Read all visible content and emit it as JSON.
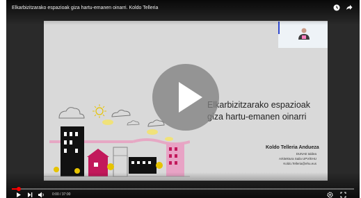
{
  "video": {
    "title": "Elkarbizitzarako espazioak giza hartu-emanen oinarri. Koldo Telleria",
    "time": "0:00 / 37:00",
    "progress_fraction": 0.02
  },
  "slide": {
    "title_line1": "Elkarbizitzarako espazioak",
    "title_line2": "giza hartu-emanen oinarri",
    "author": "Koldo Telleria Andueza",
    "aff_group": "DUNAE taldea",
    "aff_dept": "Arkitektura Saila UPV/EHU",
    "email": "Koldo.Telleria@ehu.eus"
  },
  "icons": {
    "clock": "clock-icon",
    "share": "share-icon",
    "play_big": "play-icon",
    "play": "play-icon",
    "next": "next-icon",
    "volume": "volume-icon",
    "settings": "gear-icon",
    "fullscreen": "fullscreen-icon"
  },
  "colors": {
    "progress": "#ff0000",
    "accent_slide": "#c2185b"
  }
}
